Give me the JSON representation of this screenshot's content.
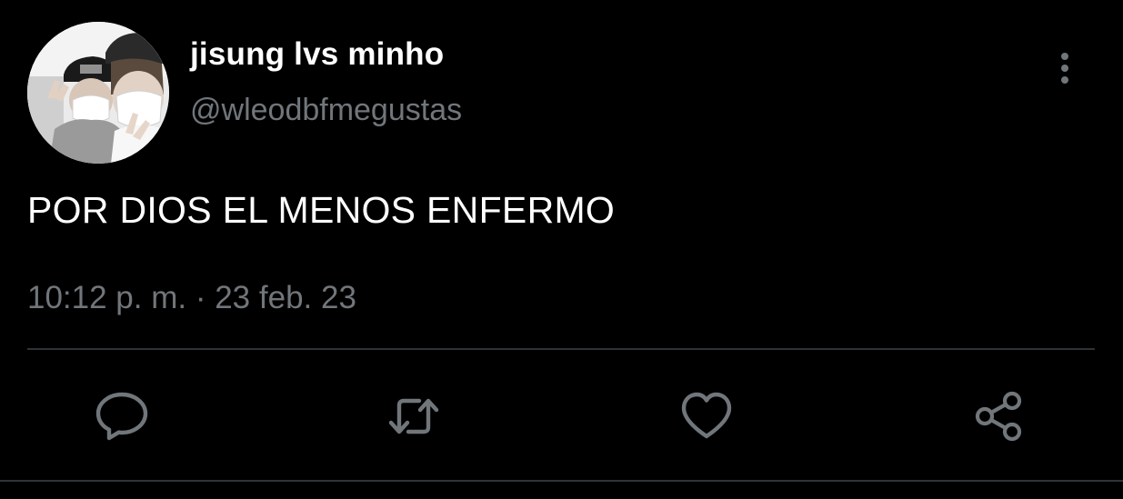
{
  "author": {
    "display_name": "jisung lvs minho",
    "handle": "@wleodbfmegustas",
    "avatar_icon": "profile-photo"
  },
  "tweet": {
    "text": "POR DIOS EL MENOS ENFERMO"
  },
  "meta": {
    "time": "10:12 p. m.",
    "separator": " · ",
    "date": "23 feb. 23"
  },
  "actions": {
    "reply_icon": "reply-icon",
    "retweet_icon": "retweet-icon",
    "like_icon": "heart-icon",
    "share_icon": "share-icon",
    "more_icon": "more-vertical-icon"
  },
  "colors": {
    "background": "#000000",
    "primary_text": "#ffffff",
    "secondary_text": "#71767b",
    "divider": "#2f3336",
    "icon": "#71767b"
  }
}
